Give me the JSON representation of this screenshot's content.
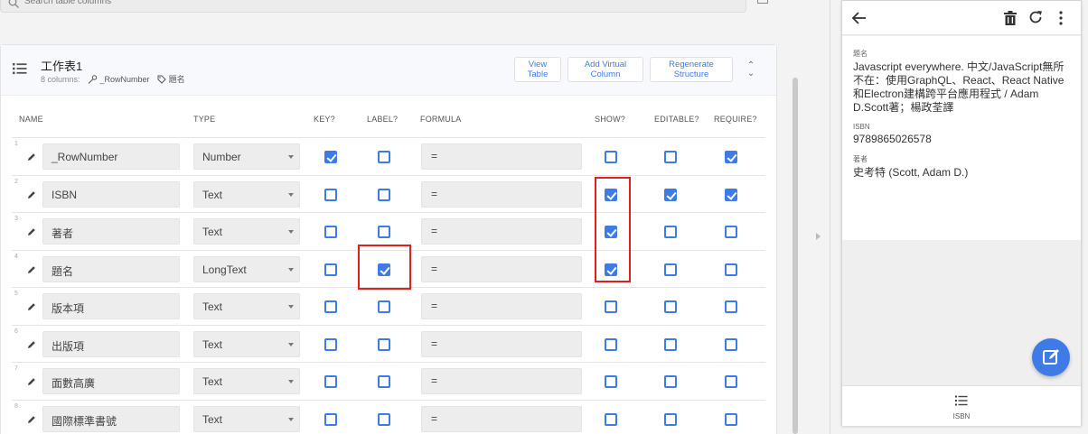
{
  "search": {
    "placeholder": "Search table columns"
  },
  "table": {
    "title": "工作表1",
    "column_count": "8 columns:",
    "key_column": "_RowNumber",
    "label_column": "題名",
    "buttons": {
      "view_table": "View\nTable",
      "add_virtual": "Add Virtual\nColumn",
      "regenerate": "Regenerate\nStructure"
    },
    "headers": {
      "name": "NAME",
      "type": "TYPE",
      "key": "KEY?",
      "label": "LABEL?",
      "formula": "FORMULA",
      "show": "SHOW?",
      "editable": "EDITABLE?",
      "require": "REQUIRE?"
    },
    "rows": [
      {
        "num": "1",
        "name": "_RowNumber",
        "type": "Number",
        "formula": "=",
        "key": true,
        "label": false,
        "show": false,
        "editable": false,
        "require": true
      },
      {
        "num": "2",
        "name": "ISBN",
        "type": "Text",
        "formula": "=",
        "key": false,
        "label": false,
        "show": true,
        "editable": true,
        "require": true
      },
      {
        "num": "3",
        "name": "著者",
        "type": "Text",
        "formula": "=",
        "key": false,
        "label": false,
        "show": true,
        "editable": false,
        "require": false
      },
      {
        "num": "4",
        "name": "題名",
        "type": "LongText",
        "formula": "=",
        "key": false,
        "label": true,
        "show": true,
        "editable": false,
        "require": false
      },
      {
        "num": "5",
        "name": "版本項",
        "type": "Text",
        "formula": "=",
        "key": false,
        "label": false,
        "show": false,
        "editable": false,
        "require": false
      },
      {
        "num": "6",
        "name": "出版項",
        "type": "Text",
        "formula": "=",
        "key": false,
        "label": false,
        "show": false,
        "editable": false,
        "require": false
      },
      {
        "num": "7",
        "name": "面數高廣",
        "type": "Text",
        "formula": "=",
        "key": false,
        "label": false,
        "show": false,
        "editable": false,
        "require": false
      },
      {
        "num": "8",
        "name": "國際標準書號",
        "type": "Text",
        "formula": "=",
        "key": false,
        "label": false,
        "show": false,
        "editable": false,
        "require": false
      }
    ]
  },
  "preview": {
    "fields": [
      {
        "label": "題名",
        "value": "Javascript everywhere. 中文/JavaScript無所不在：使用GraphQL、React、React Native和Electron建構跨平台應用程式 / Adam D.Scott著；楊政荃譯"
      },
      {
        "label": "ISBN",
        "value": "9789865026578"
      },
      {
        "label": "著者",
        "value": "史考特 (Scott, Adam D.)"
      }
    ],
    "footer_label": "ISBN"
  },
  "colors": {
    "accent": "#3f7be6",
    "highlight": "#e01f1f"
  }
}
